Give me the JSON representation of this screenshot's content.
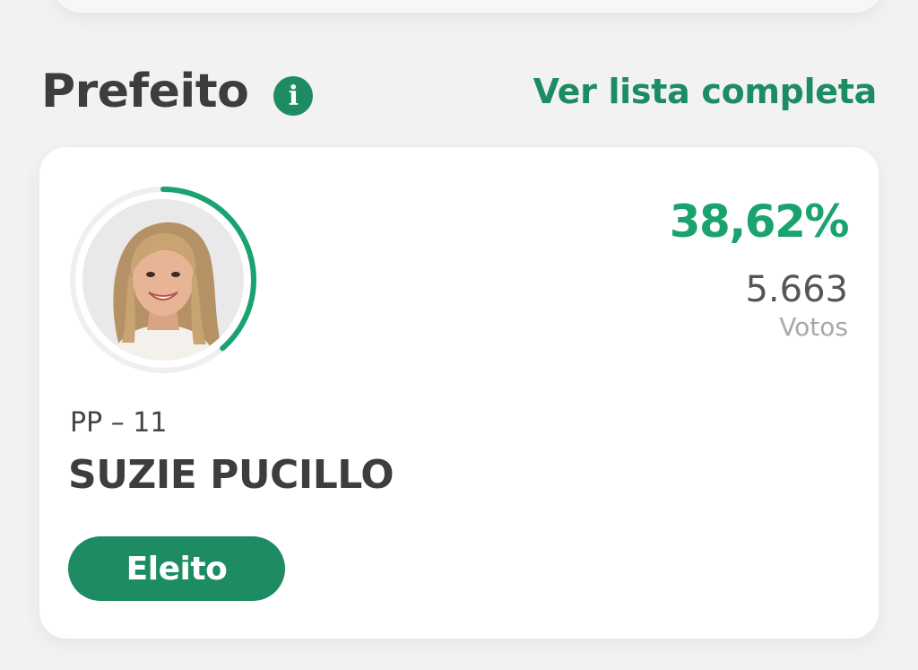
{
  "section": {
    "title": "Prefeito",
    "info_icon": "info-icon",
    "see_all_label": "Ver lista completa"
  },
  "candidate": {
    "photo": "candidate-photo",
    "percentage": "38,62%",
    "percentage_fraction": 0.3862,
    "votes": "5.663",
    "votes_label": "Votos",
    "party": "PP – 11",
    "name": "SUZIE PUCILLO",
    "status": "Eleito"
  },
  "colors": {
    "accent": "#1d8c63",
    "percentage": "#1aa36f",
    "ring_track": "#efefef",
    "background": "#f2f2f2"
  }
}
